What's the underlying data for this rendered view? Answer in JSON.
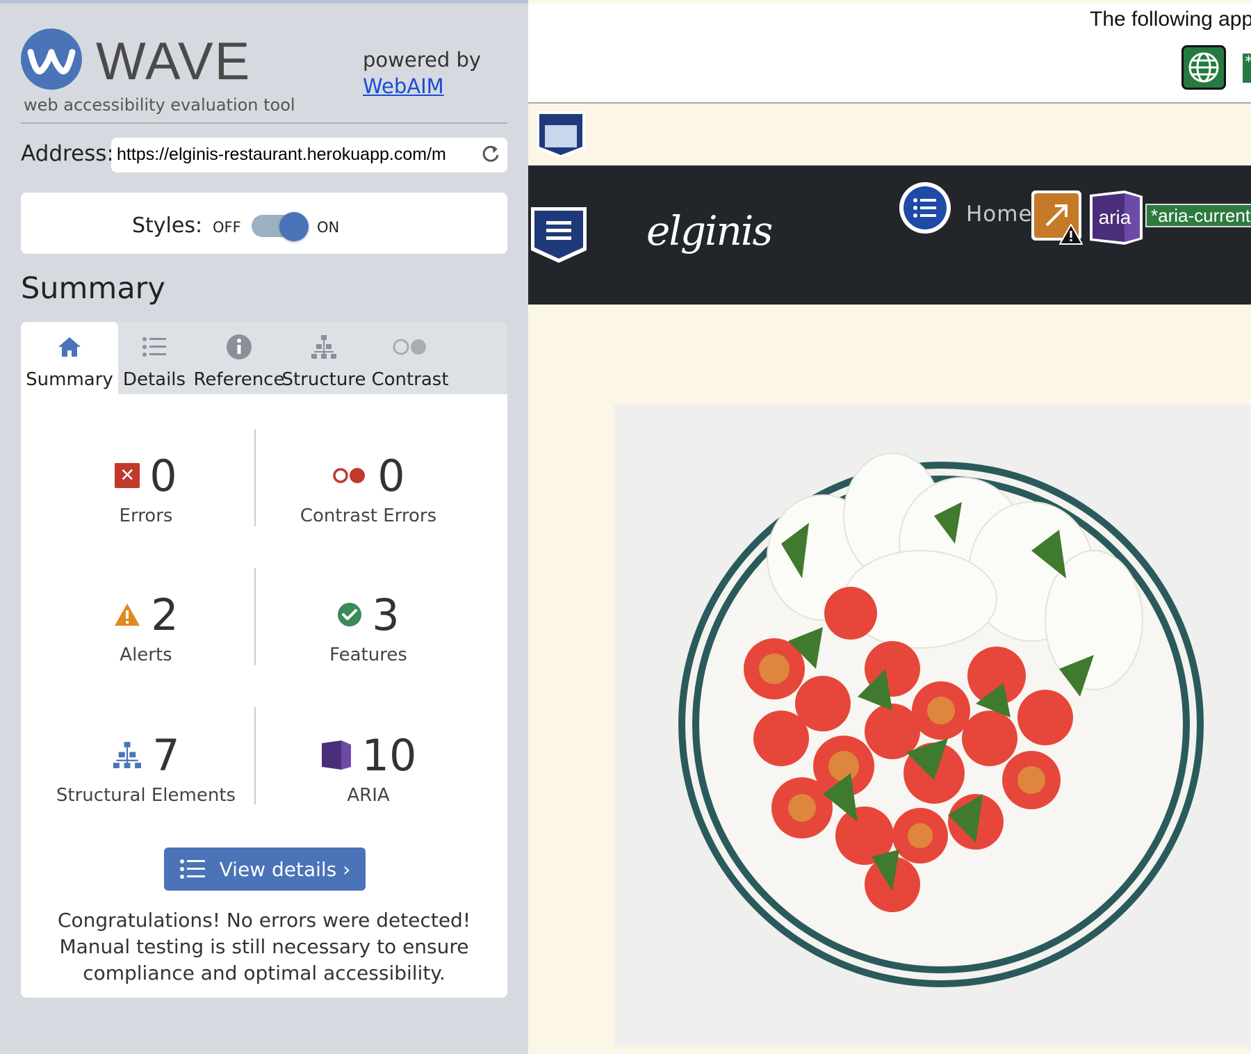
{
  "wave": {
    "title": "WAVE",
    "subtitle": "web accessibility evaluation tool",
    "powered_by": "powered by",
    "powered_link": "WebAIM"
  },
  "address": {
    "label": "Address:",
    "url": "https://elginis-restaurant.herokuapp.com/m"
  },
  "styles": {
    "label": "Styles:",
    "off": "OFF",
    "on": "ON",
    "state": "on"
  },
  "summary_heading": "Summary",
  "tabs": [
    {
      "label": "Summary",
      "icon": "home-icon",
      "active": true
    },
    {
      "label": "Details",
      "icon": "list-icon"
    },
    {
      "label": "Reference",
      "icon": "info-icon"
    },
    {
      "label": "Structure",
      "icon": "hierarchy-icon"
    },
    {
      "label": "Contrast",
      "icon": "contrast-icon"
    }
  ],
  "stats": [
    {
      "value": "0",
      "label": "Errors",
      "icon": "error-icon",
      "color": "#c0392b"
    },
    {
      "value": "0",
      "label": "Contrast Errors",
      "icon": "contrast-error-icon",
      "color": "#c0392b"
    },
    {
      "value": "2",
      "label": "Alerts",
      "icon": "alert-icon",
      "color": "#e08a1e"
    },
    {
      "value": "3",
      "label": "Features",
      "icon": "feature-check-icon",
      "color": "#3b8a5a"
    },
    {
      "value": "7",
      "label": "Structural Elements",
      "icon": "structure-icon",
      "color": "#4a73b8"
    },
    {
      "value": "10",
      "label": "ARIA",
      "icon": "aria-icon",
      "color": "#4b2e7a"
    }
  ],
  "view_details": "View details ›",
  "congrats": "Congratulations! No errors were detected! Manual testing is still necessary to ensure compliance and optimal accessibility.",
  "preview": {
    "top_text": "The following app",
    "brand": "elginis",
    "nav_home": "Home",
    "aria_icon_text": "aria",
    "aria_tag": "*aria-current",
    "edge_marker": "*"
  },
  "colors": {
    "accent": "#4a73b8",
    "sidebar_bg": "#d6dae0",
    "nav_bg": "#22262a",
    "page_bg": "#fbf6e6"
  }
}
